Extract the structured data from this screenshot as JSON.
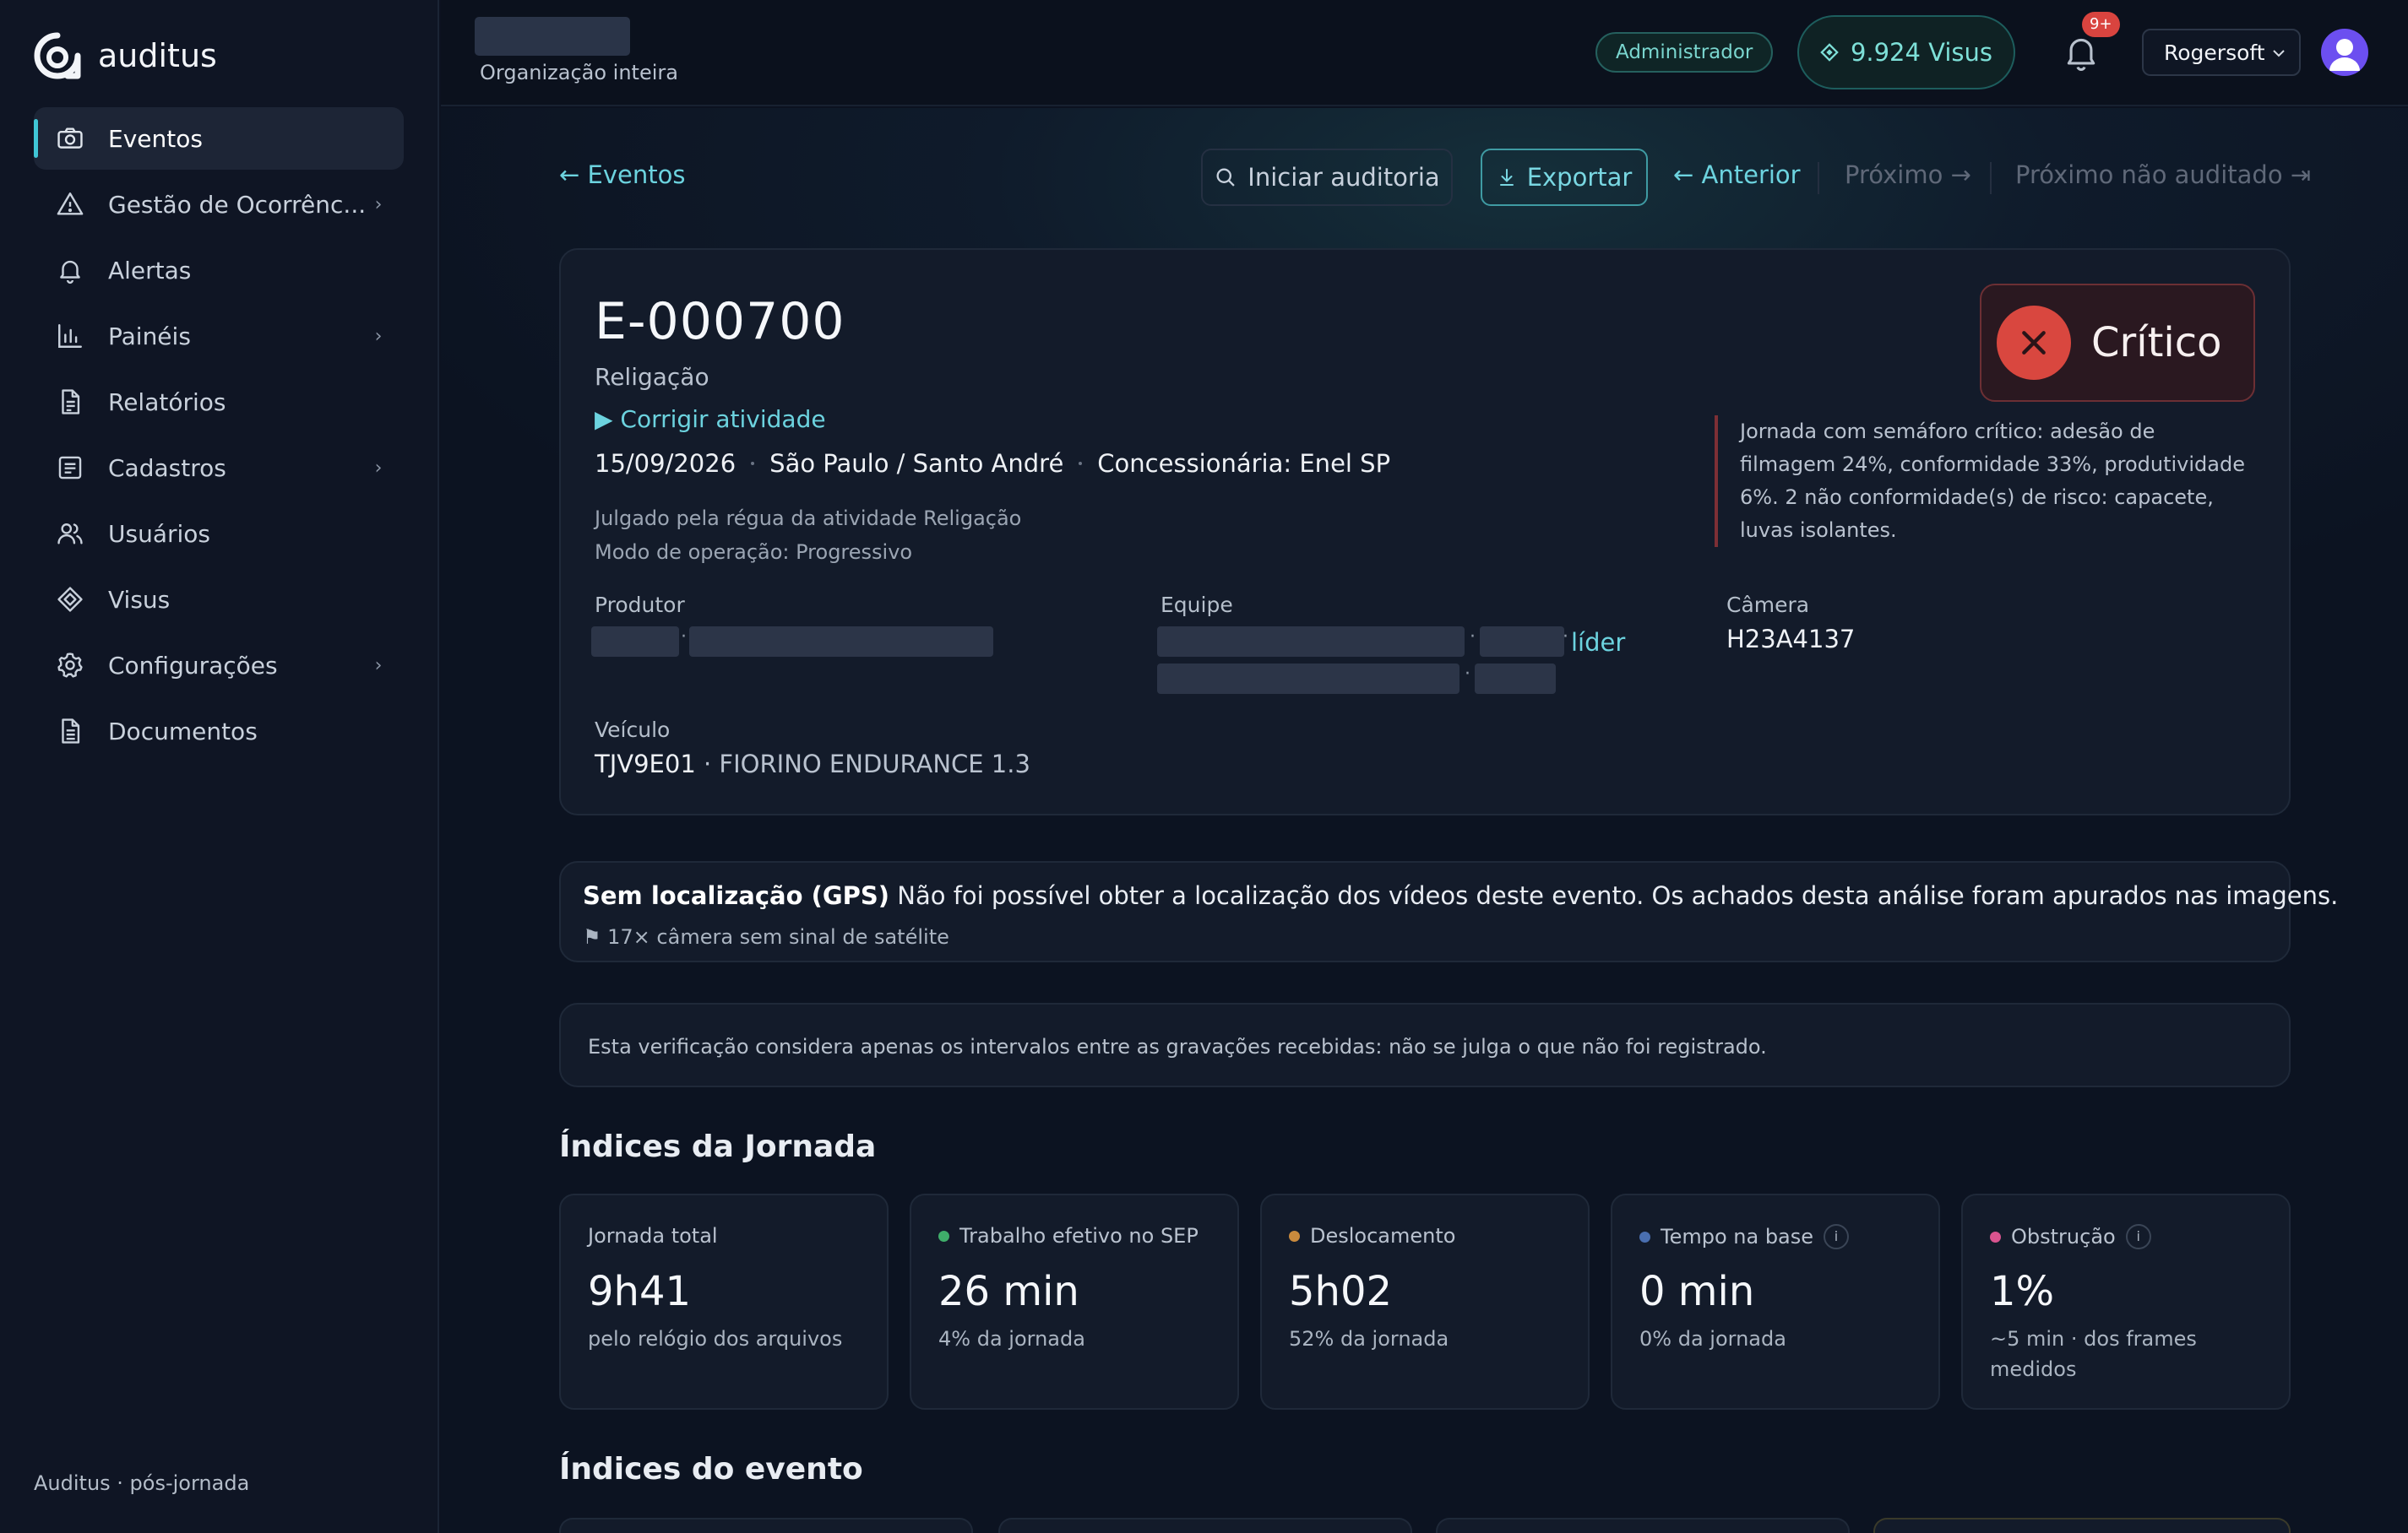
{
  "brand": {
    "name": "auditus"
  },
  "sidebar": {
    "items": [
      {
        "label": "Eventos",
        "icon": "camera-icon",
        "active": true,
        "has_submenu": false
      },
      {
        "label": "Gestão de Ocorrênc...",
        "icon": "warning-icon",
        "has_submenu": true
      },
      {
        "label": "Alertas",
        "icon": "bell-icon",
        "has_submenu": false
      },
      {
        "label": "Painéis",
        "icon": "bar-chart-icon",
        "has_submenu": true
      },
      {
        "label": "Relatórios",
        "icon": "file-icon",
        "has_submenu": false
      },
      {
        "label": "Cadastros",
        "icon": "list-icon",
        "has_submenu": true
      },
      {
        "label": "Usuários",
        "icon": "users-icon",
        "has_submenu": false
      },
      {
        "label": "Visus",
        "icon": "diamond-icon",
        "has_submenu": false
      },
      {
        "label": "Configurações",
        "icon": "gear-icon",
        "has_submenu": true
      },
      {
        "label": "Documentos",
        "icon": "document-icon",
        "has_submenu": false
      }
    ],
    "chevron": "›",
    "footer": "Auditus · pós-jornada"
  },
  "topbar": {
    "org_scope": "Organização inteira",
    "role": "Administrador",
    "visus_balance": "9.924 Visus",
    "notifications_badge": "9+",
    "user": "Rogersoft"
  },
  "toolbar": {
    "back": "← Eventos",
    "audit": "Iniciar auditoria",
    "export": "Exportar",
    "prev": "← Anterior",
    "next": "Próximo →",
    "next_unaudited": "Próximo não auditado ⇥"
  },
  "event": {
    "id": "E-000700",
    "activity": "Religação",
    "fix_activity": "▶ Corrigir atividade",
    "date": "15/09/2026",
    "location": "São Paulo / Santo André",
    "concessionaire": "Concessionária: Enel SP",
    "judged_by": "Julgado pela régua da atividade Religação",
    "operation_mode": "Modo de operação: Progressivo",
    "producer_label": "Produtor",
    "team_label": "Equipe",
    "team_leader": "líder",
    "camera_label": "Câmera",
    "camera": "H23A4137",
    "vehicle_label": "Veículo",
    "vehicle_plate": "TJV9E01",
    "vehicle_model": " · FIORINO ENDURANCE 1.3",
    "severity": "Crítico",
    "severity_color": "#d9473f",
    "severity_note": "Jornada com semáforo crítico: adesão de filmagem 24%, conformidade 33%, produtividade 6%. 2 não conformidade(s) de risco: capacete, luvas isolantes."
  },
  "gps": {
    "title": "Sem localização (GPS)",
    "message": " Não foi possível obter a localização dos vídeos deste evento. Os achados desta análise foram apurados nas imagens.",
    "detail": "⚑ 17× câmera sem sinal de satélite"
  },
  "verification_note": "Esta verificação considera apenas os intervalos entre as gravações recebidas: não se julga o que não foi registrado.",
  "journey_section": {
    "title": "Índices da Jornada",
    "cards": [
      {
        "label": "Jornada total",
        "value": "9h41",
        "sub": "pelo relógio dos arquivos",
        "dot": null,
        "info": false
      },
      {
        "label": "Trabalho efetivo no SEP",
        "value": "26 min",
        "sub": "4% da jornada",
        "dot": "#3fae6a",
        "info": false
      },
      {
        "label": "Deslocamento",
        "value": "5h02",
        "sub": "52% da jornada",
        "dot": "#c98a3d",
        "info": false
      },
      {
        "label": "Tempo na base",
        "value": "0 min",
        "sub": "0% da jornada",
        "dot": "#4a6fb0",
        "info": true
      },
      {
        "label": "Obstrução",
        "value": "1%",
        "sub": "~5 min · dos frames medidos",
        "dot": "#d9548f",
        "info": true
      }
    ]
  },
  "event_section": {
    "title": "Índices do evento"
  },
  "colors": {
    "accent": "#40c6d6",
    "background": "#0c1220",
    "card": "#131b2a",
    "critical": "#d9473f"
  }
}
